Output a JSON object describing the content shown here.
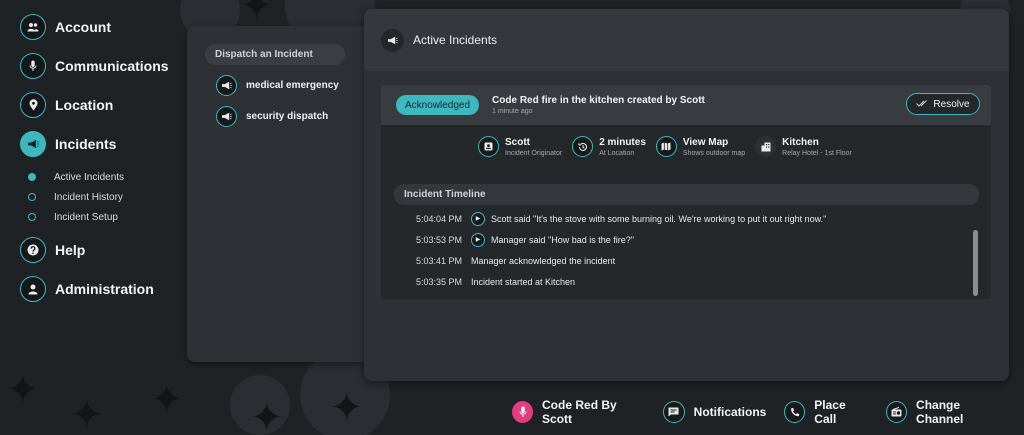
{
  "nav": {
    "items": [
      {
        "label": "Account",
        "icon": "people-icon"
      },
      {
        "label": "Communications",
        "icon": "microphone-icon"
      },
      {
        "label": "Location",
        "icon": "location-pin-icon"
      },
      {
        "label": "Incidents",
        "icon": "megaphone-icon"
      }
    ],
    "incident_sub": [
      {
        "label": "Active Incidents"
      },
      {
        "label": "Incident History"
      },
      {
        "label": "Incident Setup"
      }
    ],
    "help": {
      "label": "Help",
      "icon": "question-icon"
    },
    "administration": {
      "label": "Administration",
      "icon": "person-icon"
    }
  },
  "dispatch": {
    "header": "Dispatch an Incident",
    "items": [
      {
        "label": "medical emergency",
        "icon": "megaphone-icon"
      },
      {
        "label": "security dispatch",
        "icon": "megaphone-icon"
      }
    ]
  },
  "main": {
    "title": "Active Incidents",
    "incident": {
      "status": "Acknowledged",
      "title": "Code Red fire in the kitchen created by Scott",
      "time_ago": "1 minute ago",
      "resolve_label": "Resolve",
      "facts": [
        {
          "main": "Scott",
          "sub": "Incident Originator",
          "icon": "badge-icon"
        },
        {
          "main": "2 minutes",
          "sub": "At Location",
          "icon": "history-icon"
        },
        {
          "main": "View Map",
          "sub": "Shows outdoor map",
          "icon": "map-icon"
        },
        {
          "main": "Kitchen",
          "sub": "Relay Hotel - 1st Floor",
          "icon": "building-icon"
        }
      ],
      "timeline_header": "Incident Timeline",
      "timeline": [
        {
          "time": "5:04:04 PM",
          "text": "Scott said \"It's the stove with some burning oil. We're working to put it out right now.\""
        },
        {
          "time": "5:03:53 PM",
          "text": "Manager said \"How bad is the fire?\""
        },
        {
          "time": "5:03:41 PM",
          "text": "Manager acknowledged the incident"
        },
        {
          "time": "5:03:35 PM",
          "text": "Incident started at Kitchen"
        }
      ]
    }
  },
  "bottom_bar": {
    "alert": "Code Red By Scott",
    "notifications": "Notifications",
    "place_call": "Place Call",
    "change_channel": "Change Channel"
  },
  "colors": {
    "accent": "#3fb7bf",
    "alert": "#e33d82",
    "background": "#1f2225",
    "panel": "#2d3135"
  }
}
